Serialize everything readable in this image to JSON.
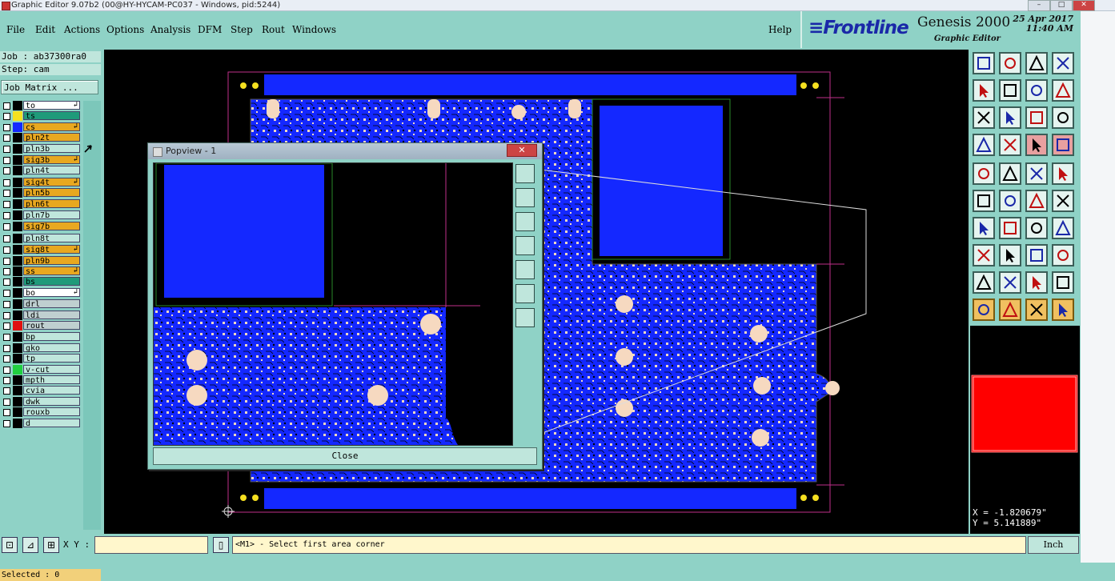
{
  "window": {
    "title": "Graphic Editor 9.07b2 (00@HY-HYCAM-PC037 - Windows, pid:5244)"
  },
  "menubar": {
    "items": [
      "File",
      "Edit",
      "Actions",
      "Options",
      "Analysis",
      "DFM",
      "Step",
      "Rout",
      "Windows"
    ],
    "help": "Help"
  },
  "brand": {
    "logo": "≡Frontline",
    "product": "Genesis 2000",
    "subtitle": "Graphic Editor",
    "date": "25 Apr 2017",
    "time": "11:40 AM"
  },
  "job": {
    "job_line": "Job : ab37300ra0",
    "step_line": "Step: cam",
    "matrix_button": "Job Matrix ..."
  },
  "layers": [
    {
      "name": "to",
      "color": "#000000",
      "bg": "#ffffff",
      "arrow": true
    },
    {
      "name": "ts",
      "color": "#f5e020",
      "bg": "#1f9a7a",
      "arrow": false
    },
    {
      "name": "cs",
      "color": "#1428ff",
      "bg": "#e8a820",
      "arrow": true
    },
    {
      "name": "pln2t",
      "color": "#000000",
      "bg": "#e8a820",
      "arrow": false
    },
    {
      "name": "pln3b",
      "color": "#000000",
      "bg": "#bfe6dc",
      "arrow": false
    },
    {
      "name": "sig3b",
      "color": "#000000",
      "bg": "#e8a820",
      "arrow": true
    },
    {
      "name": "pln4t",
      "color": "#000000",
      "bg": "#bfe6dc",
      "arrow": false
    },
    {
      "name": "sig4t",
      "color": "#000000",
      "bg": "#e8a820",
      "arrow": true
    },
    {
      "name": "pln5b",
      "color": "#000000",
      "bg": "#e8a820",
      "arrow": false
    },
    {
      "name": "pln6t",
      "color": "#000000",
      "bg": "#e8a820",
      "arrow": false
    },
    {
      "name": "pln7b",
      "color": "#000000",
      "bg": "#bfe6dc",
      "arrow": false
    },
    {
      "name": "sig7b",
      "color": "#000000",
      "bg": "#e8a820",
      "arrow": false
    },
    {
      "name": "pln8t",
      "color": "#000000",
      "bg": "#bfe6dc",
      "arrow": false
    },
    {
      "name": "sig8t",
      "color": "#000000",
      "bg": "#e8a820",
      "arrow": true
    },
    {
      "name": "pln9b",
      "color": "#000000",
      "bg": "#e8a820",
      "arrow": false
    },
    {
      "name": "ss",
      "color": "#000000",
      "bg": "#e8a820",
      "arrow": true
    },
    {
      "name": "bs",
      "color": "#000000",
      "bg": "#1f9a7a",
      "arrow": false
    },
    {
      "name": "bo",
      "color": "#000000",
      "bg": "#ffffff",
      "arrow": true
    },
    {
      "name": "drl",
      "color": "#000000",
      "bg": "#bfcfd0",
      "arrow": false
    },
    {
      "name": "ldi",
      "color": "#000000",
      "bg": "#bfcfd0",
      "arrow": false
    },
    {
      "name": "rout",
      "color": "#e01010",
      "bg": "#bfcfd0",
      "arrow": false
    },
    {
      "name": "bp",
      "color": "#000000",
      "bg": "#bfe6dc",
      "arrow": false
    },
    {
      "name": "gko",
      "color": "#000000",
      "bg": "#bfe6dc",
      "arrow": false
    },
    {
      "name": "tp",
      "color": "#000000",
      "bg": "#bfe6dc",
      "arrow": false
    },
    {
      "name": "v-cut",
      "color": "#20d040",
      "bg": "#bfe6dc",
      "arrow": false
    },
    {
      "name": "mpth",
      "color": "#000000",
      "bg": "#bfe6dc",
      "arrow": false
    },
    {
      "name": "cvia",
      "color": "#000000",
      "bg": "#bfe6dc",
      "arrow": false
    },
    {
      "name": "dwk",
      "color": "#000000",
      "bg": "#bfe6dc",
      "arrow": false
    },
    {
      "name": "rouxb",
      "color": "#000000",
      "bg": "#bfe6dc",
      "arrow": false
    },
    {
      "name": "d",
      "color": "#000000",
      "bg": "#bfe6dc",
      "arrow": false
    }
  ],
  "selected": "Selected : 0",
  "popview": {
    "title": "Popview - 1",
    "close_label": "Close",
    "close_x": "✕"
  },
  "coords": {
    "x": "X = -1.820679\"",
    "y": "Y = 5.141889\""
  },
  "bottom": {
    "xy_label": "X Y :",
    "xy_value": "",
    "status": "<M1> - Select first area corner",
    "unit": "Inch"
  },
  "colors": {
    "board": "#1428ff",
    "pad": "#f6d9c0",
    "background": "#000000",
    "selected_rout": "#ff0000"
  },
  "icons": [
    "appicon",
    "layer-arrow-icon",
    "tool-icons",
    "minimap",
    "popview-tools"
  ]
}
